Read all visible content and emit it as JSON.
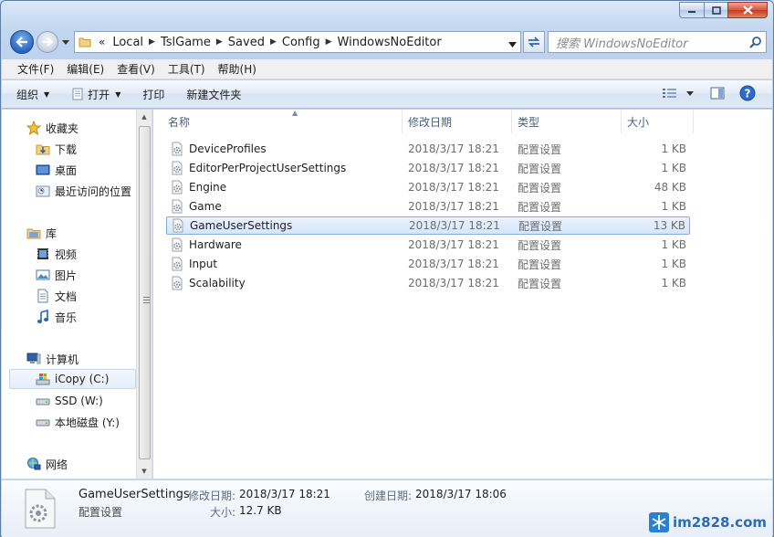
{
  "window": {
    "min_icon": "minimize-icon",
    "max_icon": "maximize-icon",
    "close_icon": "close-icon"
  },
  "address": {
    "overflow": "«",
    "parts": [
      "Local",
      "TslGame",
      "Saved",
      "Config",
      "WindowsNoEditor"
    ]
  },
  "search": {
    "placeholder": "搜索 WindowsNoEditor"
  },
  "menu": [
    "文件(F)",
    "编辑(E)",
    "查看(V)",
    "工具(T)",
    "帮助(H)"
  ],
  "commands": {
    "organize": "组织",
    "open": "打开",
    "print": "打印",
    "new_folder": "新建文件夹"
  },
  "nav": {
    "favorites": "收藏夹",
    "downloads": "下载",
    "desktop": "桌面",
    "recent": "最近访问的位置",
    "libraries": "库",
    "videos": "视频",
    "pictures": "图片",
    "documents": "文档",
    "music": "音乐",
    "computer": "计算机",
    "drive_c": "iCopy (C:)",
    "drive_w": "SSD (W:)",
    "drive_y": "本地磁盘 (Y:)",
    "network": "网络"
  },
  "columns": {
    "name": "名称",
    "date": "修改日期",
    "type": "类型",
    "size": "大小"
  },
  "files": [
    {
      "name": "DeviceProfiles",
      "date": "2018/3/17 18:21",
      "type": "配置设置",
      "size": "1 KB"
    },
    {
      "name": "EditorPerProjectUserSettings",
      "date": "2018/3/17 18:21",
      "type": "配置设置",
      "size": "1 KB"
    },
    {
      "name": "Engine",
      "date": "2018/3/17 18:21",
      "type": "配置设置",
      "size": "48 KB"
    },
    {
      "name": "Game",
      "date": "2018/3/17 18:21",
      "type": "配置设置",
      "size": "1 KB"
    },
    {
      "name": "GameUserSettings",
      "date": "2018/3/17 18:21",
      "type": "配置设置",
      "size": "13 KB"
    },
    {
      "name": "Hardware",
      "date": "2018/3/17 18:21",
      "type": "配置设置",
      "size": "1 KB"
    },
    {
      "name": "Input",
      "date": "2018/3/17 18:21",
      "type": "配置设置",
      "size": "1 KB"
    },
    {
      "name": "Scalability",
      "date": "2018/3/17 18:21",
      "type": "配置设置",
      "size": "1 KB"
    }
  ],
  "selected_index": 4,
  "details": {
    "name": "GameUserSettings",
    "type": "配置设置",
    "modified_label": "修改日期:",
    "modified_value": "2018/3/17 18:21",
    "created_label": "创建日期:",
    "created_value": "2018/3/17 18:06",
    "size_label": "大小:",
    "size_value": "12.7 KB"
  },
  "watermark": "im2828.com"
}
